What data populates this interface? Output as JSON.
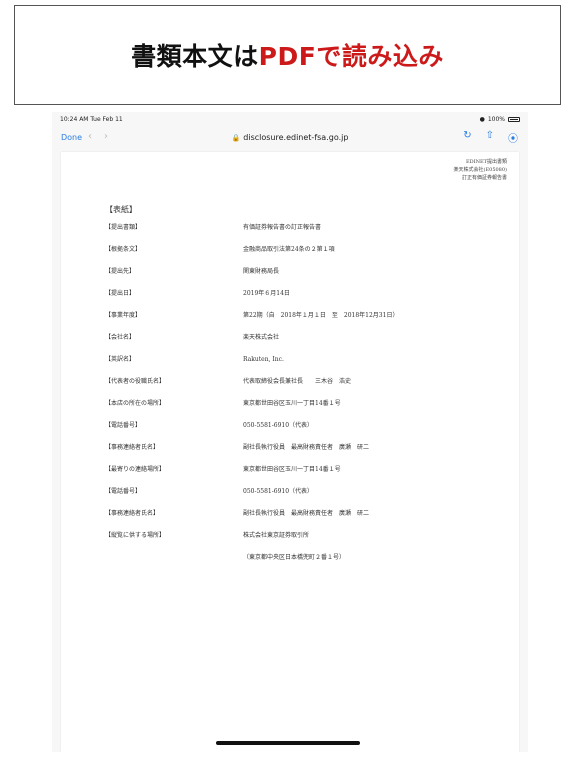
{
  "banner": {
    "part1": "書類本文は",
    "part2": "PDFで読み込み"
  },
  "status": {
    "time": "10:24 AM  Tue Feb 11",
    "battery": "100%"
  },
  "toolbar": {
    "done": "Done",
    "url": "disclosure.edinet-fsa.go.jp"
  },
  "document": {
    "header": [
      "EDINET提出書類",
      "楽天株式会社(E05080)",
      "訂正有価証券報告書"
    ],
    "title": "【表紙】",
    "rows": [
      {
        "k": "【提出書類】",
        "v": "有価証券報告書の訂正報告書"
      },
      {
        "k": "【根拠条文】",
        "v": "金融商品取引法第24条の２第１項"
      },
      {
        "k": "【提出先】",
        "v": "関東財務局長"
      },
      {
        "k": "【提出日】",
        "v": "2019年６月14日"
      },
      {
        "k": "【事業年度】",
        "v": "第22期（自　2018年１月１日　至　2018年12月31日）"
      },
      {
        "k": "【会社名】",
        "v": "楽天株式会社"
      },
      {
        "k": "【英訳名】",
        "v": "Rakuten, Inc."
      },
      {
        "k": "【代表者の役職氏名】",
        "v": "代表取締役会長兼社長　　三木谷　浩史"
      },
      {
        "k": "【本店の所在の場所】",
        "v": "東京都世田谷区玉川一丁目14番１号"
      },
      {
        "k": "【電話番号】",
        "v": "050-5581-6910（代表）"
      },
      {
        "k": "【事務連絡者氏名】",
        "v": "副社長執行役員　最高財務責任者　廣瀬　研二"
      },
      {
        "k": "【最寄りの連絡場所】",
        "v": "東京都世田谷区玉川一丁目14番１号"
      },
      {
        "k": "【電話番号】",
        "v": "050-5581-6910（代表）"
      },
      {
        "k": "【事務連絡者氏名】",
        "v": "副社長執行役員　最高財務責任者　廣瀬　研二"
      },
      {
        "k": "【縦覧に供する場所】",
        "v": "株式会社東京証券取引所"
      },
      {
        "k": "",
        "v": "（東京都中央区日本橋兜町２番１号）"
      }
    ]
  }
}
